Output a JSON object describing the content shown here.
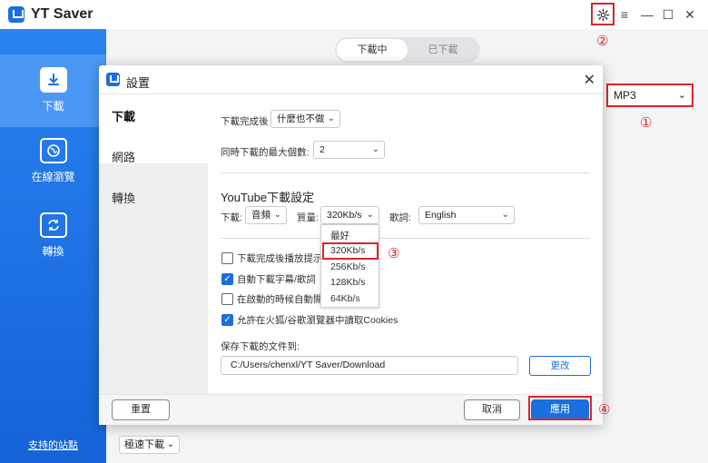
{
  "app": {
    "title": "YT Saver"
  },
  "titlebar": {
    "gear": "gear-icon",
    "menu": "≡",
    "minimize": "—",
    "maximize": "☐",
    "close": "✕"
  },
  "sidebar": {
    "items": [
      {
        "label": "下載",
        "icon": "download-icon"
      },
      {
        "label": "在線瀏覽",
        "icon": "globe-icon"
      },
      {
        "label": "轉換",
        "icon": "convert-icon"
      }
    ],
    "support": "支持的站點"
  },
  "main": {
    "tabs": [
      "下載中",
      "已下載"
    ],
    "format": "MP3",
    "speed": "極速下載"
  },
  "annotations": {
    "m1": "①",
    "m2": "②",
    "m3": "③",
    "m4": "④"
  },
  "dialog": {
    "title": "設置",
    "nav": [
      "下載",
      "網路",
      "轉換"
    ],
    "after_download_label": "下載完成後",
    "after_download_value": "什麼也不做",
    "max_downloads_label": "同時下載的最大個數:",
    "max_downloads_value": "2",
    "youtube_title": "YouTube下載設定",
    "dl_label": "下載:",
    "dl_value": "音頻",
    "quality_label": "質量:",
    "quality_value": "320Kb/s",
    "lyrics_label": "歌詞:",
    "lyrics_value": "English",
    "quality_options": [
      "最好",
      "320Kb/s",
      "256Kb/s",
      "128Kb/s",
      "64Kb/s"
    ],
    "checkboxes": [
      {
        "label": "下載完成後播放提示音",
        "checked": false
      },
      {
        "label": "自動下載字幕/歌詞",
        "checked": true
      },
      {
        "label": "在啟動的時候自動開始",
        "checked": false
      },
      {
        "label": "允許在火狐/谷歌瀏覽器中讀取Cookies",
        "checked": true
      }
    ],
    "save_label": "保存下載的文件到:",
    "save_path": "C:/Users/chenxl/YT Saver/Download",
    "change_btn": "更改",
    "reset_btn": "重置",
    "cancel_btn": "取消",
    "apply_btn": "應用"
  },
  "colors": {
    "accent": "#1a6fe0",
    "highlight": "#d9252b"
  }
}
